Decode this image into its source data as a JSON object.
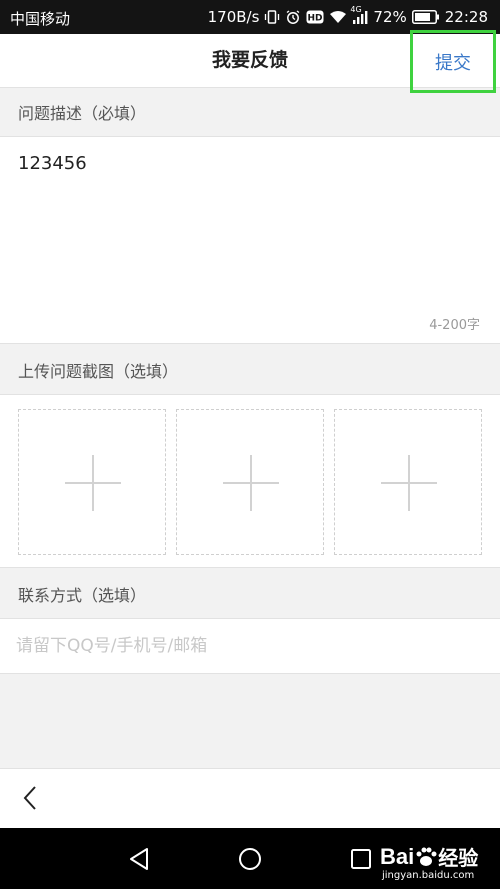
{
  "status_bar": {
    "carrier": "中国移动",
    "net_speed": "170B/s",
    "signal_tag": "4G",
    "battery": "72%",
    "time": "22:28",
    "icons": [
      "vibrate-icon",
      "alarm-icon",
      "hd-icon",
      "wifi-icon",
      "cell-signal-icon",
      "battery-icon"
    ]
  },
  "header": {
    "title": "我要反馈",
    "submit_label": "提交"
  },
  "description": {
    "label": "问题描述（必填）",
    "value": "123456",
    "counter": "4-200字"
  },
  "screenshots": {
    "label": "上传问题截图（选填）",
    "slots": [
      "add-icon",
      "add-icon",
      "add-icon"
    ]
  },
  "contact": {
    "label": "联系方式（选填）",
    "placeholder": "请留下QQ号/手机号/邮箱"
  },
  "toolbar": {
    "back_icon": "back-icon"
  },
  "system_nav": {
    "icons": [
      "nav-back-icon",
      "nav-home-icon",
      "nav-recents-icon"
    ]
  },
  "watermark": {
    "logo_text": "Bai",
    "logo_suffix": "经验",
    "url": "jingyan.baidu.com"
  }
}
